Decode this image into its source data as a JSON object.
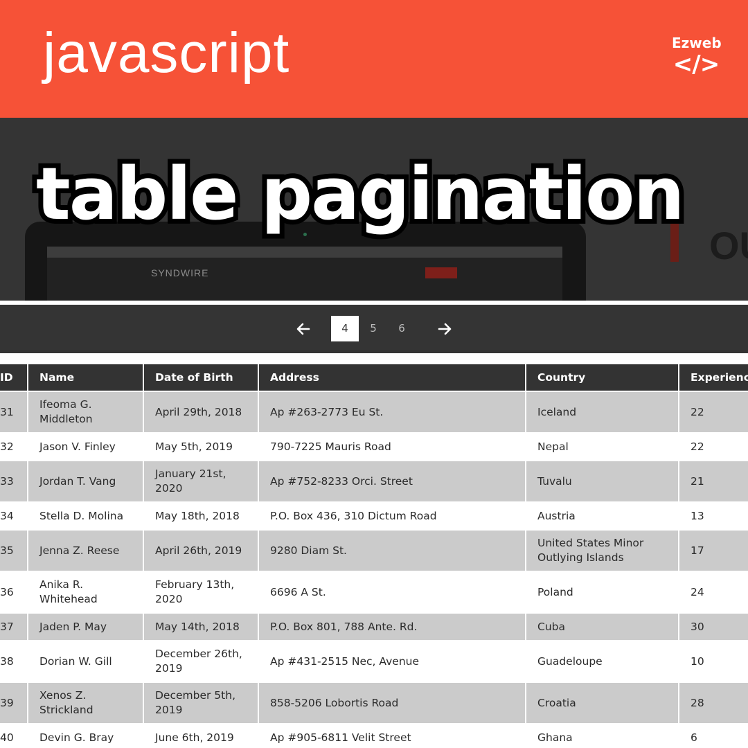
{
  "header": {
    "title": "javascript",
    "brand_name": "Ezweb",
    "brand_icon": "</>",
    "background": "#f65237"
  },
  "banner": {
    "title": "table pagination",
    "thumbnail_logo": "SYNDWIRE",
    "thumbnail_partial_text": "OU"
  },
  "pagination": {
    "prev_icon": "arrow-left-icon",
    "next_icon": "arrow-right-icon",
    "pages": [
      "4",
      "5",
      "6"
    ],
    "active_page": "4"
  },
  "table": {
    "columns": [
      "ID",
      "Name",
      "Date of Birth",
      "Address",
      "Country",
      "Experience"
    ],
    "rows": [
      [
        "31",
        "Ifeoma G. Middleton",
        "April 29th, 2018",
        "Ap #263-2773 Eu St.",
        "Iceland",
        "22"
      ],
      [
        "32",
        "Jason V. Finley",
        "May 5th, 2019",
        "790-7225 Mauris Road",
        "Nepal",
        "22"
      ],
      [
        "33",
        "Jordan T. Vang",
        "January 21st, 2020",
        "Ap #752-8233 Orci. Street",
        "Tuvalu",
        "21"
      ],
      [
        "34",
        "Stella D. Molina",
        "May 18th, 2018",
        "P.O. Box 436, 310 Dictum Road",
        "Austria",
        "13"
      ],
      [
        "35",
        "Jenna Z. Reese",
        "April 26th, 2019",
        "9280 Diam St.",
        "United States Minor Outlying Islands",
        "17"
      ],
      [
        "36",
        "Anika R. Whitehead",
        "February 13th, 2020",
        "6696 A St.",
        "Poland",
        "24"
      ],
      [
        "37",
        "Jaden P. May",
        "May 14th, 2018",
        "P.O. Box 801, 788 Ante. Rd.",
        "Cuba",
        "30"
      ],
      [
        "38",
        "Dorian W. Gill",
        "December 26th, 2019",
        "Ap #431-2515 Nec, Avenue",
        "Guadeloupe",
        "10"
      ],
      [
        "39",
        "Xenos Z. Strickland",
        "December 5th, 2019",
        "858-5206 Lobortis Road",
        "Croatia",
        "28"
      ],
      [
        "40",
        "Devin G. Bray",
        "June 6th, 2019",
        "Ap #905-6811 Velit Street",
        "Ghana",
        "6"
      ]
    ]
  }
}
